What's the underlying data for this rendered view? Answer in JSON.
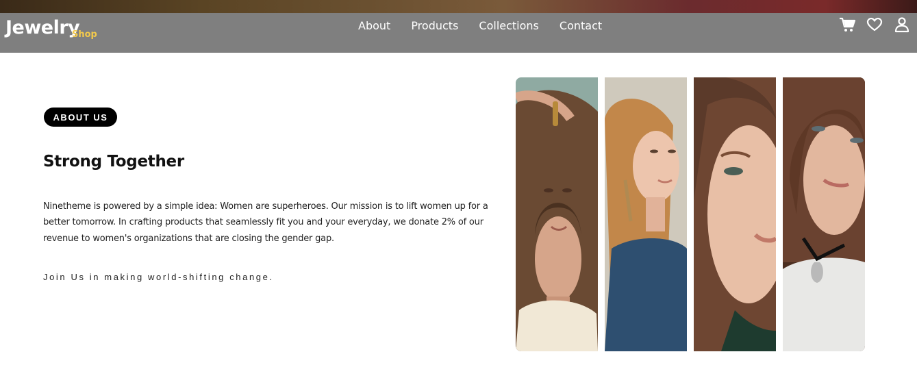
{
  "header": {
    "logo_main": "Jewelry",
    "logo_sub": "Shop",
    "nav": [
      {
        "label": "About"
      },
      {
        "label": "Products"
      },
      {
        "label": "Collections"
      },
      {
        "label": "Contact"
      }
    ],
    "icons": [
      "cart-icon",
      "heart-icon",
      "user-icon"
    ]
  },
  "about": {
    "badge": "ABOUT US",
    "title": "Strong Together",
    "body": "Ninetheme is powered by a simple idea: Women are superheroes. Our mission is to lift women up for a better tomorrow. In crafting products that seamlessly fit you and your everyday, we donate 2% of our revenue to women's organizations that are closing the gender gap.",
    "cta": "Join Us in making world-shifting change."
  },
  "gallery": {
    "photos": [
      "model-photo-1",
      "model-photo-2",
      "model-photo-3",
      "model-photo-4"
    ]
  },
  "colors": {
    "navbar_bg": "#7f7f7f",
    "accent_gold": "#f2c94c",
    "badge_bg": "#000000"
  }
}
